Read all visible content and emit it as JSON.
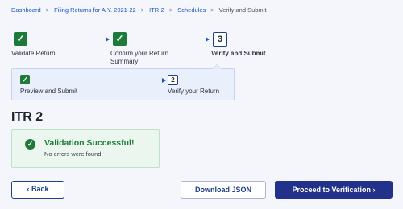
{
  "breadcrumb": {
    "items": [
      "Dashboard",
      "Filing Returns for A.Y. 2021-22",
      "ITR-2",
      "Schedules"
    ],
    "current": "Verify and Submit",
    "separator": ">"
  },
  "stepper": {
    "steps": [
      {
        "label": "Validate Return",
        "state": "done"
      },
      {
        "label_line1": "Confirm your Return",
        "label_line2": "Summary",
        "state": "done"
      },
      {
        "number": "3",
        "label": "Verify and Submit",
        "state": "active"
      }
    ],
    "substeps": [
      {
        "label": "Preview and Submit",
        "state": "done"
      },
      {
        "number": "2",
        "label": "Verify your Return",
        "state": "active"
      }
    ]
  },
  "page_title": "ITR 2",
  "validation": {
    "title": "Validation Successful!",
    "message": "No errors were found."
  },
  "buttons": {
    "back": "Back",
    "back_icon": "chevron-left",
    "download": "Download JSON",
    "proceed": "Proceed to Verification",
    "proceed_icon": "chevron-right"
  },
  "colors": {
    "success": "#1e7a3a",
    "primary": "#22318a",
    "link": "#1a55c4"
  }
}
